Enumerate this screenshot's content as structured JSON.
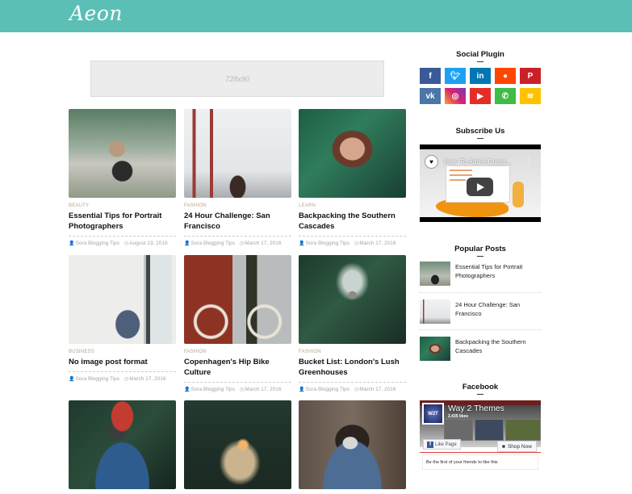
{
  "header": {
    "logo": "Aeon",
    "background_color": "#5bbfb6"
  },
  "ad": {
    "label": "728x90"
  },
  "posts": [
    {
      "category": "Beauty",
      "title": "Essential Tips for Portrait Photographers",
      "author": "Sora Blogging Tips",
      "date": "August 23, 2016",
      "image": "woman-in-garden-holding-flower"
    },
    {
      "category": "Fashion",
      "title": "24 Hour Challenge: San Francisco",
      "author": "Sora Blogging Tips",
      "date": "March 17, 2016",
      "image": "two-women-golden-gate-bridge"
    },
    {
      "category": "Learn",
      "title": "Backpacking the Southern Cascades",
      "author": "Sora Blogging Tips",
      "date": "March 17, 2016",
      "image": "woman-portrait-in-foliage"
    },
    {
      "category": "Business",
      "title": "No image post format",
      "author": "Sora Blogging Tips",
      "date": "March 17, 2016",
      "image": "man-working-at-laptop"
    },
    {
      "category": "Fashion",
      "title": "Copenhagen's Hip Bike Culture",
      "author": "Sora Blogging Tips",
      "date": "March 17, 2016",
      "image": "woman-with-bicycle-red-door"
    },
    {
      "category": "Fashion",
      "title": "Bucket List: London's Lush Greenhouses",
      "author": "Sora Blogging Tips",
      "date": "March 17, 2016",
      "image": "greenhouse-path"
    },
    {
      "image": "woman-red-hat-camera"
    },
    {
      "image": "woman-with-sparkler"
    },
    {
      "image": "bearded-man-with-camera"
    }
  ],
  "sidebar": {
    "social_title": "Social Plugin",
    "social": [
      {
        "name": "facebook",
        "glyph": "f",
        "color": "#3b5998"
      },
      {
        "name": "twitter",
        "glyph": "t",
        "color": "#1da1f2"
      },
      {
        "name": "linkedin",
        "glyph": "in",
        "color": "#0077b5"
      },
      {
        "name": "reddit",
        "glyph": "●",
        "color": "#ff4500"
      },
      {
        "name": "pinterest",
        "glyph": "P",
        "color": "#cb2027"
      },
      {
        "name": "vk",
        "glyph": "vk",
        "color": "#4a76a8"
      },
      {
        "name": "instagram",
        "glyph": "◎",
        "color": "#c13584"
      },
      {
        "name": "youtube",
        "glyph": "▶",
        "color": "#e52d27"
      },
      {
        "name": "whatsapp",
        "glyph": "✆",
        "color": "#3fbb46"
      },
      {
        "name": "rss",
        "glyph": "≋",
        "color": "#ffc200"
      }
    ],
    "subscribe_title": "Subscribe Us",
    "video": {
      "title": "How To Add A Custo..."
    },
    "popular_title": "Popular Posts",
    "popular": [
      {
        "title": "Essential Tips for Portrait Photographers"
      },
      {
        "title": "24 Hour Challenge: San Francisco"
      },
      {
        "title": "Backpacking the Southern Cascades"
      }
    ],
    "facebook_title": "Facebook",
    "facebook": {
      "page_name": "Way 2 Themes",
      "likes": "2,435 likes",
      "like_button": "Like Page",
      "shop_button": "Shop Now",
      "friends_text": "Be the first of your friends to like this",
      "avatar_text": "W2T"
    }
  }
}
